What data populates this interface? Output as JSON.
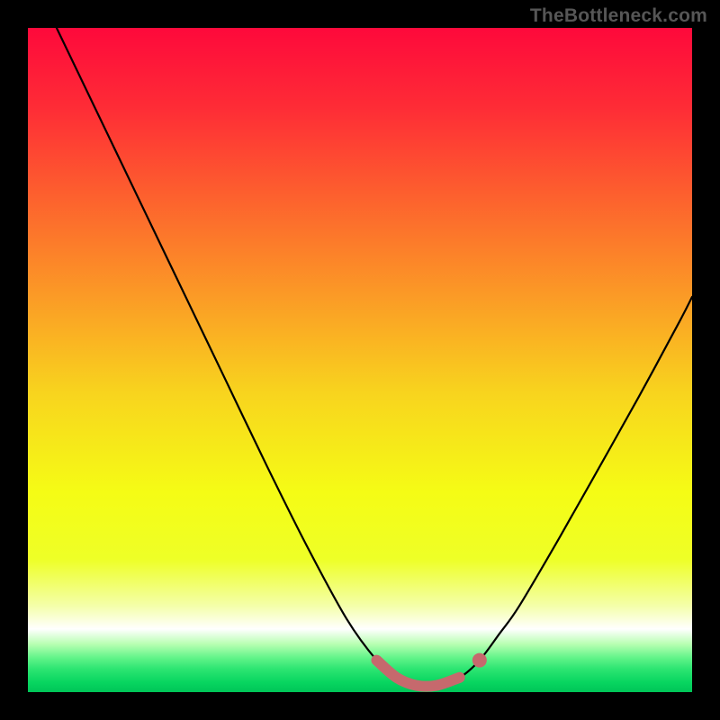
{
  "watermark": {
    "text": "TheBottleneck.com"
  },
  "colors": {
    "curve": "#000000",
    "highlight_stroke": "#c6696d",
    "highlight_fill": "#c6696d",
    "frame": "#000000",
    "gradient_stops": [
      {
        "offset": 0.0,
        "color": "#fe093b"
      },
      {
        "offset": 0.12,
        "color": "#fe2c36"
      },
      {
        "offset": 0.25,
        "color": "#fd5f2e"
      },
      {
        "offset": 0.4,
        "color": "#fb9926"
      },
      {
        "offset": 0.55,
        "color": "#f8d41e"
      },
      {
        "offset": 0.7,
        "color": "#f5fc15"
      },
      {
        "offset": 0.8,
        "color": "#eeff27"
      },
      {
        "offset": 0.87,
        "color": "#f4ffa9"
      },
      {
        "offset": 0.905,
        "color": "#ffffff"
      },
      {
        "offset": 0.928,
        "color": "#b7ffb1"
      },
      {
        "offset": 0.948,
        "color": "#63f48a"
      },
      {
        "offset": 0.965,
        "color": "#2de572"
      },
      {
        "offset": 0.985,
        "color": "#08d660"
      },
      {
        "offset": 1.0,
        "color": "#00c558"
      }
    ]
  },
  "chart_data": {
    "type": "line",
    "title": "",
    "xlabel": "",
    "ylabel": "",
    "xlim": [
      0,
      1
    ],
    "ylim": [
      0,
      1
    ],
    "grid": false,
    "series": [
      {
        "name": "bottleneck-curve",
        "x": [
          0.0,
          0.06,
          0.12,
          0.18,
          0.24,
          0.3,
          0.36,
          0.42,
          0.48,
          0.525,
          0.555,
          0.585,
          0.615,
          0.65,
          0.68,
          0.71,
          0.74,
          0.8,
          0.86,
          0.92,
          0.98,
          1.0
        ],
        "y": [
          1.09,
          0.965,
          0.84,
          0.715,
          0.59,
          0.465,
          0.34,
          0.22,
          0.11,
          0.048,
          0.022,
          0.01,
          0.01,
          0.022,
          0.048,
          0.088,
          0.13,
          0.232,
          0.338,
          0.445,
          0.556,
          0.595
        ]
      }
    ],
    "highlight_region": {
      "x": [
        0.525,
        0.555,
        0.585,
        0.615,
        0.65
      ],
      "y": [
        0.048,
        0.022,
        0.01,
        0.01,
        0.022
      ]
    },
    "highlight_dot": {
      "x": 0.68,
      "y": 0.048
    }
  }
}
